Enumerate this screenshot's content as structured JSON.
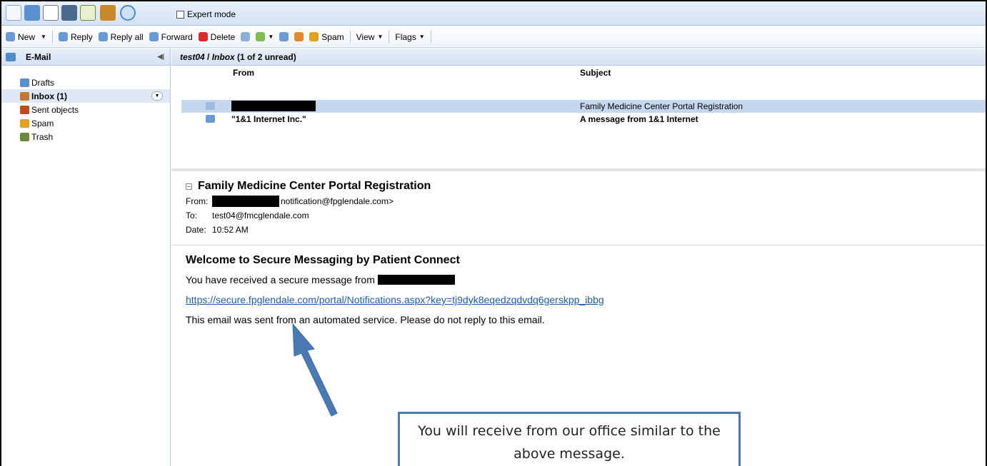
{
  "topbar": {
    "expert_mode_label": "Expert mode",
    "icons": [
      "home-icon",
      "mail-icon",
      "calendar-icon",
      "contacts-icon",
      "tasks-icon",
      "briefcase-icon",
      "settings-icon"
    ]
  },
  "toolbar": {
    "new": "New",
    "reply": "Reply",
    "reply_all": "Reply all",
    "forward": "Forward",
    "delete": "Delete",
    "spam": "Spam",
    "view": "View",
    "flags": "Flags"
  },
  "sidebar": {
    "title": "E-Mail",
    "folders": [
      {
        "label": "Drafts",
        "icon": "drafts-icon",
        "color": "#5a8fd0"
      },
      {
        "label": "Inbox (1)",
        "icon": "inbox-icon",
        "color": "#c07a2a"
      },
      {
        "label": "Sent objects",
        "icon": "sent-icon",
        "color": "#c04a1a"
      },
      {
        "label": "Spam",
        "icon": "spam-icon",
        "color": "#e0a020"
      },
      {
        "label": "Trash",
        "icon": "trash-icon",
        "color": "#6a8a3a"
      }
    ]
  },
  "list": {
    "path_user": "test04",
    "path_folder": "Inbox",
    "unread_info": "(1 of 2 unread)",
    "col_from": "From",
    "col_subject": "Subject",
    "rows": [
      {
        "from": "",
        "subject": "Family Medicine Center Portal Registration",
        "read": true
      },
      {
        "from": "\"1&1 Internet Inc.\"",
        "subject": "A message from 1&1 Internet",
        "read": false
      }
    ]
  },
  "message": {
    "title": "Family Medicine Center Portal Registration",
    "from_label": "From:",
    "from_value": "notification@fpglendale.com>",
    "to_label": "To:",
    "to_value": "test04@fmcglendale.com",
    "date_label": "Date:",
    "date_value": "10:52 AM",
    "heading": "Welcome to Secure Messaging by Patient Connect",
    "line1": "You have received a secure message from",
    "link": "https://secure.fpglendale.com/portal/Notifications.aspx?key=tj9dyk8eqedzqdvdq6gerskpp_ibbg",
    "line3": "This email was sent from an automated service. Please do not reply to this email."
  },
  "callout": {
    "text": "You will receive from our office similar to the above message."
  },
  "colors": {
    "accent": "#4a7ab3",
    "selected_row": "#c5d7ee",
    "link": "#1a5db3"
  }
}
